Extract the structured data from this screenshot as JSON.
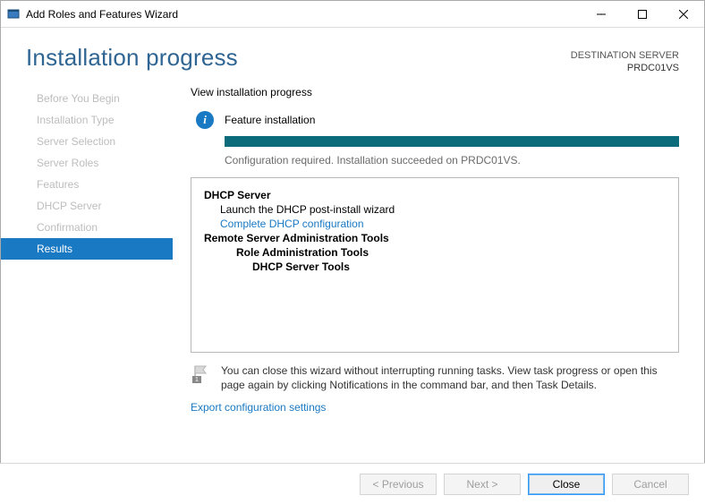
{
  "window": {
    "title": "Add Roles and Features Wizard"
  },
  "header": {
    "page_title": "Installation progress",
    "destination_label": "DESTINATION SERVER",
    "destination_server": "PRDC01VS"
  },
  "sidebar": {
    "items": [
      {
        "label": "Before You Begin"
      },
      {
        "label": "Installation Type"
      },
      {
        "label": "Server Selection"
      },
      {
        "label": "Server Roles"
      },
      {
        "label": "Features"
      },
      {
        "label": "DHCP Server"
      },
      {
        "label": "Confirmation"
      },
      {
        "label": "Results"
      }
    ],
    "active_index": 7
  },
  "main": {
    "section_label": "View installation progress",
    "status_title": "Feature installation",
    "progress_percent": 100,
    "status_message": "Configuration required. Installation succeeded on PRDC01VS.",
    "results": {
      "role": "DHCP Server",
      "role_hint": "Launch the DHCP post-install wizard",
      "role_link": "Complete DHCP configuration",
      "rsat": "Remote Server Administration Tools",
      "rsat_sub": "Role Administration Tools",
      "rsat_sub2": "DHCP Server Tools"
    },
    "note": "You can close this wizard without interrupting running tasks. View task progress or open this page again by clicking Notifications in the command bar, and then Task Details.",
    "export_link": "Export configuration settings"
  },
  "footer": {
    "previous": "< Previous",
    "next": "Next >",
    "close": "Close",
    "cancel": "Cancel"
  }
}
